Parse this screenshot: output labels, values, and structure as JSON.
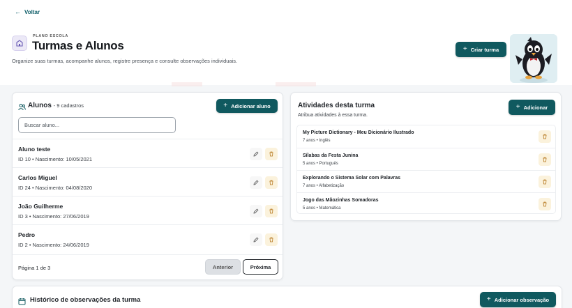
{
  "nav": {
    "back_label": "Voltar"
  },
  "header": {
    "eyebrow": "PLANO ESCOLA",
    "title": "Turmas e Alunos",
    "subtitle": "Organize suas turmas, acompanhe alunos, registre presença e consulte observações individuais.",
    "create_button": "Criar turma"
  },
  "alunos": {
    "title": "Alunos",
    "count": "- 9 cadastros",
    "add_button": "Adicionar aluno",
    "search_placeholder": "Buscar aluno...",
    "students": [
      {
        "name": "Aluno teste",
        "meta": "ID 10 • Nascimento: 10/05/2021"
      },
      {
        "name": "Carlos Miguel",
        "meta": "ID 24 • Nascimento: 04/08/2020"
      },
      {
        "name": "João Guilherme",
        "meta": "ID 3 • Nascimento: 27/06/2019"
      },
      {
        "name": "Pedro",
        "meta": "ID 2 • Nascimento: 24/06/2019"
      }
    ],
    "pagination": {
      "label": "Página 1 de 3",
      "prev": "Anterior",
      "next": "Próxima"
    }
  },
  "atividades": {
    "title": "Atividades desta turma",
    "subtitle": "Atribua atividades à essa turma.",
    "add_button": "Adicionar",
    "items": [
      {
        "name": "My Picture Dictionary - Meu Dicionário Ilustrado",
        "meta": "7 anos • Inglês"
      },
      {
        "name": "Sílabas da Festa Junina",
        "meta": "5 anos • Português"
      },
      {
        "name": "Explorando o Sistema Solar com Palavras",
        "meta": "7 anos • Alfabetização"
      },
      {
        "name": "Jogo das Mãozinhas Somadoras",
        "meta": "5 anos • Matemática"
      }
    ]
  },
  "historico": {
    "title": "Histórico de observações da turma",
    "add_button": "Adicionar observação"
  },
  "colors": {
    "primary": "#10595f",
    "delete_bg": "#fbf2dc",
    "page_bg": "#f4f6f8"
  },
  "icons": [
    "arrow-left-icon",
    "school-icon",
    "plus-icon",
    "users-icon",
    "pencil-icon",
    "trash-icon",
    "calendar-icon"
  ]
}
